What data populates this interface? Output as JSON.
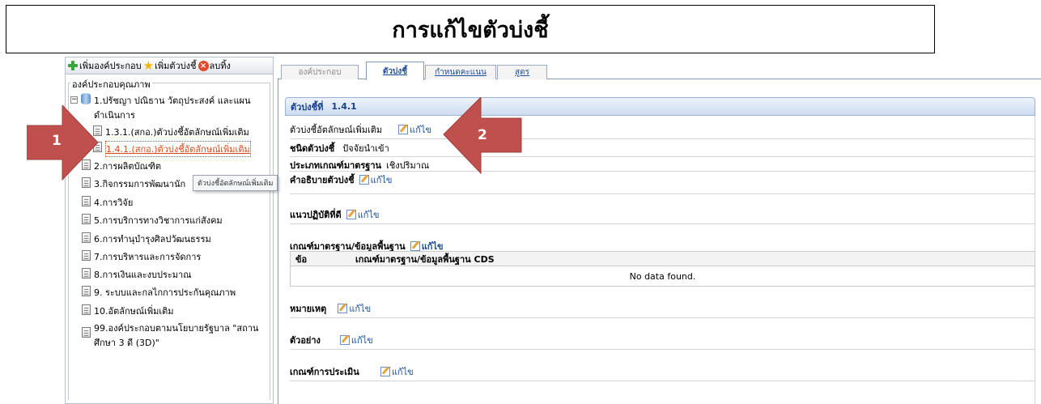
{
  "page_title": "การแก้ไขตัวบ่งชี้",
  "toolbar": {
    "add_component": "เพิ่มองค์ประกอบ",
    "add_indicator": "เพิ่มตัวบ่งชี้",
    "delete_all": "ลบทิ้ง"
  },
  "tree": {
    "group_label": "องค์ประกอบคุณภาพ",
    "root": {
      "line1": "1.ปรัชญา ปณิธาน วัตถุประสงค์ และแผน",
      "line2": "ดำเนินการ",
      "expander": "−"
    },
    "children": [
      "1.3.1.(สกอ.)ตัวบ่งชี้อัตลักษณ์เพิ่มเติม",
      "1.4.1.(สกอ.)ตัวบ่งชี้อัตลักษณ์เพิ่มเติม"
    ],
    "items": [
      "2.การผลิตบัณฑิต",
      "3.กิจกรรมการพัฒนานัก",
      "4.การวิจัย",
      "5.การบริการทางวิชาการแก่สังคม",
      "6.การทำนุบำรุงศิลปวัฒนธรรม",
      "7.การบริหารและการจัดการ",
      "8.การเงินและงบประมาณ",
      "9. ระบบและกลไกการประกันคุณภาพ",
      "10.อัตลักษณ์เพิ่มเติม"
    ],
    "last_item": {
      "line1": "99.องค์ประกอบตามนโยบายรัฐบาล \"สถาน",
      "line2": "ศึกษา 3 ดี (3D)\""
    },
    "tooltip": "ตัวบ่งชี้อัตลักษณ์เพิ่มเติม"
  },
  "tabs": [
    {
      "label": "องค์ประกอบ",
      "state": "disabled"
    },
    {
      "label": "ตัวบ่งชี้",
      "state": "active"
    },
    {
      "label": "กำหนดคะแนน",
      "state": "normal"
    },
    {
      "label": "สูตร",
      "state": "normal"
    }
  ],
  "indicator": {
    "header_label": "ตัวบ่งชี้ที่",
    "header_number": "1.4.1",
    "name": "ตัวบ่งชี้อัตลักษณ์เพิ่มเติม",
    "edit_label": "แก้ไข",
    "type_label": "ชนิดตัวบ่งชี้",
    "type_value": "ปัจจัยนำเข้า",
    "criteria_type_label": "ประเภทเกณฑ์มาตรฐาน",
    "criteria_type_value": "เชิงปริมาณ",
    "description_label": "คำอธิบายตัวบ่งชี้",
    "best_practice_label": "แนวปฏิบัติที่ดี",
    "criteria_label": "เกณฑ์มาตรฐาน/ข้อมูลพื้นฐาน",
    "grid_col_no": "ข้อ",
    "grid_col_criteria": "เกณฑ์มาตรฐาน/ข้อมูลพื้นฐาน CDS",
    "grid_empty": "No data found.",
    "remark_label": "หมายเหตุ",
    "example_label": "ตัวอย่าง",
    "evaluation_label": "เกณฑ์การประเมิน"
  },
  "callouts": [
    "1",
    "2"
  ],
  "colors": {
    "arrow": "#c0504d",
    "accent_link": "#1f4e99",
    "selected_item": "#d84a1b"
  }
}
